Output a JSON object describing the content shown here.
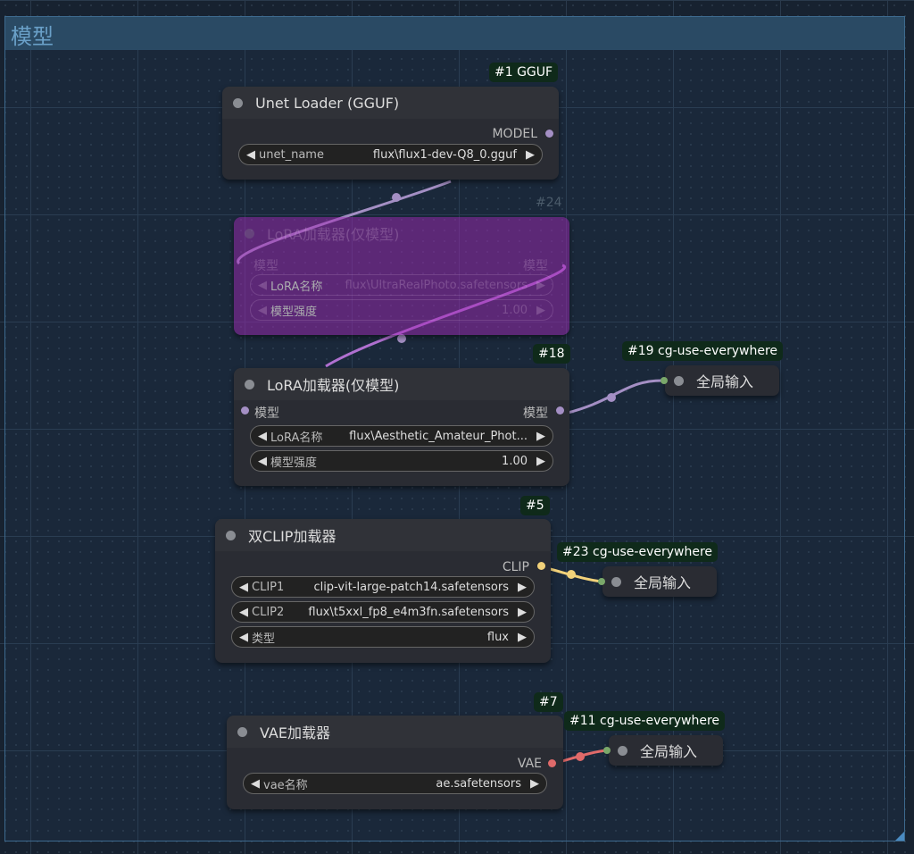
{
  "group": {
    "title": "模型"
  },
  "nodes": {
    "unet": {
      "badge": "#1 GGUF",
      "title": "Unet Loader (GGUF)",
      "output": "MODEL",
      "widget": {
        "label": "unet_name",
        "value": "flux\\flux1-dev-Q8_0.gguf"
      }
    },
    "lora24": {
      "badge": "#24",
      "title": "LoRA加载器(仅模型)",
      "input": "模型",
      "output": "模型",
      "widgets": [
        {
          "label": "LoRA名称",
          "value": "flux\\UltraRealPhoto.safetensors"
        },
        {
          "label": "模型强度",
          "value": "1.00"
        }
      ],
      "mode": "bypassed"
    },
    "lora18": {
      "badge": "#18",
      "title": "LoRA加载器(仅模型)",
      "input": "模型",
      "output": "模型",
      "widgets": [
        {
          "label": "LoRA名称",
          "value": "flux\\Aesthetic_Amateur_Phot..."
        },
        {
          "label": "模型强度",
          "value": "1.00"
        }
      ]
    },
    "clip": {
      "badge": "#5",
      "title": "双CLIP加载器",
      "output": "CLIP",
      "widgets": [
        {
          "label": "CLIP1",
          "value": "clip-vit-large-patch14.safetensors"
        },
        {
          "label": "CLIP2",
          "value": "flux\\t5xxl_fp8_e4m3fn.safetensors"
        },
        {
          "label": "类型",
          "value": "flux"
        }
      ]
    },
    "vae": {
      "badge": "#7",
      "title": "VAE加载器",
      "output": "VAE",
      "widget": {
        "label": "vae名称",
        "value": "ae.safetensors"
      }
    },
    "ue19": {
      "badge": "#19 cg-use-everywhere",
      "label": "全局输入"
    },
    "ue23": {
      "badge": "#23 cg-use-everywhere",
      "label": "全局输入"
    },
    "ue11": {
      "badge": "#11 cg-use-everywhere",
      "label": "全局输入"
    }
  },
  "colors": {
    "model": "#a48fc4",
    "clip": "#f2d27a",
    "vae": "#e06a6a",
    "bypass": "#9a28b4"
  }
}
